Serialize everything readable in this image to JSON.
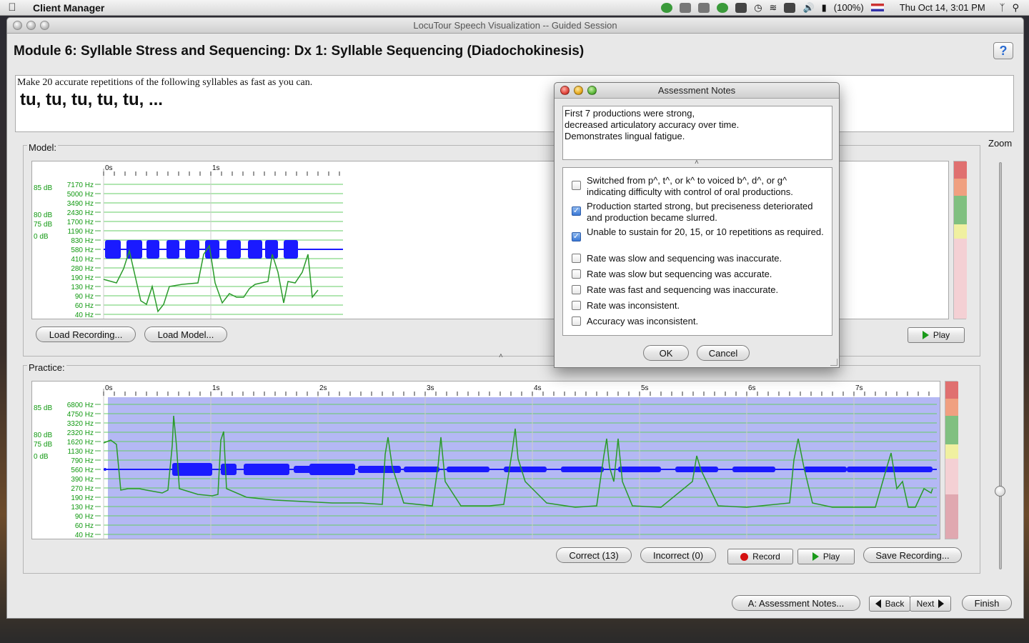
{
  "menubar": {
    "app_name": "Client Manager",
    "battery": "(100%)",
    "datetime": "Thu Oct 14,  3:01 PM",
    "icons": [
      "apple-icon",
      "growl-icon",
      "wrench-icon",
      "sync-icon",
      "accessibility-icon",
      "time-machine-icon",
      "wifi-icon",
      "display-icon",
      "volume-icon",
      "battery-icon",
      "flag-icon",
      "bluetooth-icon",
      "spotlight-icon"
    ]
  },
  "window": {
    "title": "LocuTour Speech Visualization -- Guided Session",
    "module_title": "Module 6: Syllable Stress and Sequencing: Dx 1: Syllable Sequencing (Diadochokinesis)",
    "help_label": "?"
  },
  "prompt": {
    "instruction": "Make 20 accurate repetitions of the following syllables as fast as you can.",
    "syllables": "tu, tu, tu, tu, tu, ..."
  },
  "model": {
    "label": "Model:",
    "time_ticks": [
      "0s",
      "1s"
    ],
    "freq_labels": [
      "7170 Hz",
      "5000 Hz",
      "3490 Hz",
      "2430 Hz",
      "1700 Hz",
      "1190 Hz",
      "830 Hz",
      "580 Hz",
      "410 Hz",
      "280 Hz",
      "190 Hz",
      "130 Hz",
      "90 Hz",
      "60 Hz",
      "40 Hz"
    ],
    "db_labels": [
      "85 dB",
      "80 dB",
      "75 dB",
      "0 dB"
    ],
    "load_recording": "Load Recording...",
    "load_model": "Load Model...",
    "play": "Play"
  },
  "practice": {
    "label": "Practice:",
    "time_ticks": [
      "0s",
      "1s",
      "2s",
      "3s",
      "4s",
      "5s",
      "6s",
      "7s"
    ],
    "freq_labels": [
      "6800 Hz",
      "4750 Hz",
      "3320 Hz",
      "2320 Hz",
      "1620 Hz",
      "1130 Hz",
      "790 Hz",
      "560 Hz",
      "390 Hz",
      "270 Hz",
      "190 Hz",
      "130 Hz",
      "90 Hz",
      "60 Hz",
      "40 Hz"
    ],
    "db_labels": [
      "85 dB",
      "80 dB",
      "75 dB",
      "0 dB"
    ],
    "correct": "Correct (13)",
    "incorrect": "Incorrect (0)",
    "record": "Record",
    "play": "Play",
    "save": "Save Recording..."
  },
  "zoom": {
    "label": "Zoom"
  },
  "footer": {
    "assessment": "A: Assessment Notes...",
    "back": "Back",
    "next": "Next",
    "finish": "Finish"
  },
  "dialog": {
    "title": "Assessment Notes",
    "notes": "First 7 productions were strong,\ndecreased articulatory accuracy over time.\nDemonstrates lingual fatigue.",
    "items": [
      {
        "label": "Switched from p^, t^, or k^ to voiced b^, d^, or g^ indicating difficulty with control of oral productions.",
        "checked": false
      },
      {
        "label": "Production started strong, but preciseness deteriorated and production became slurred.",
        "checked": true
      },
      {
        "label": "Unable to sustain for 20, 15, or 10 repetitions as required.",
        "checked": true
      },
      {
        "label": "Rate was slow and sequencing was inaccurate.",
        "checked": false
      },
      {
        "label": "Rate was slow but sequencing was accurate.",
        "checked": false
      },
      {
        "label": "Rate was fast and sequencing was inaccurate.",
        "checked": false
      },
      {
        "label": "Rate was inconsistent.",
        "checked": false
      },
      {
        "label": "Accuracy was inconsistent.",
        "checked": false
      }
    ],
    "ok": "OK",
    "cancel": "Cancel"
  },
  "colors": {
    "waveform": "#1a1aff",
    "pitch": "#2a9a2a",
    "grid": "#66cc66",
    "axis_text": "#119911",
    "practice_bg": "#b4b8f4"
  }
}
